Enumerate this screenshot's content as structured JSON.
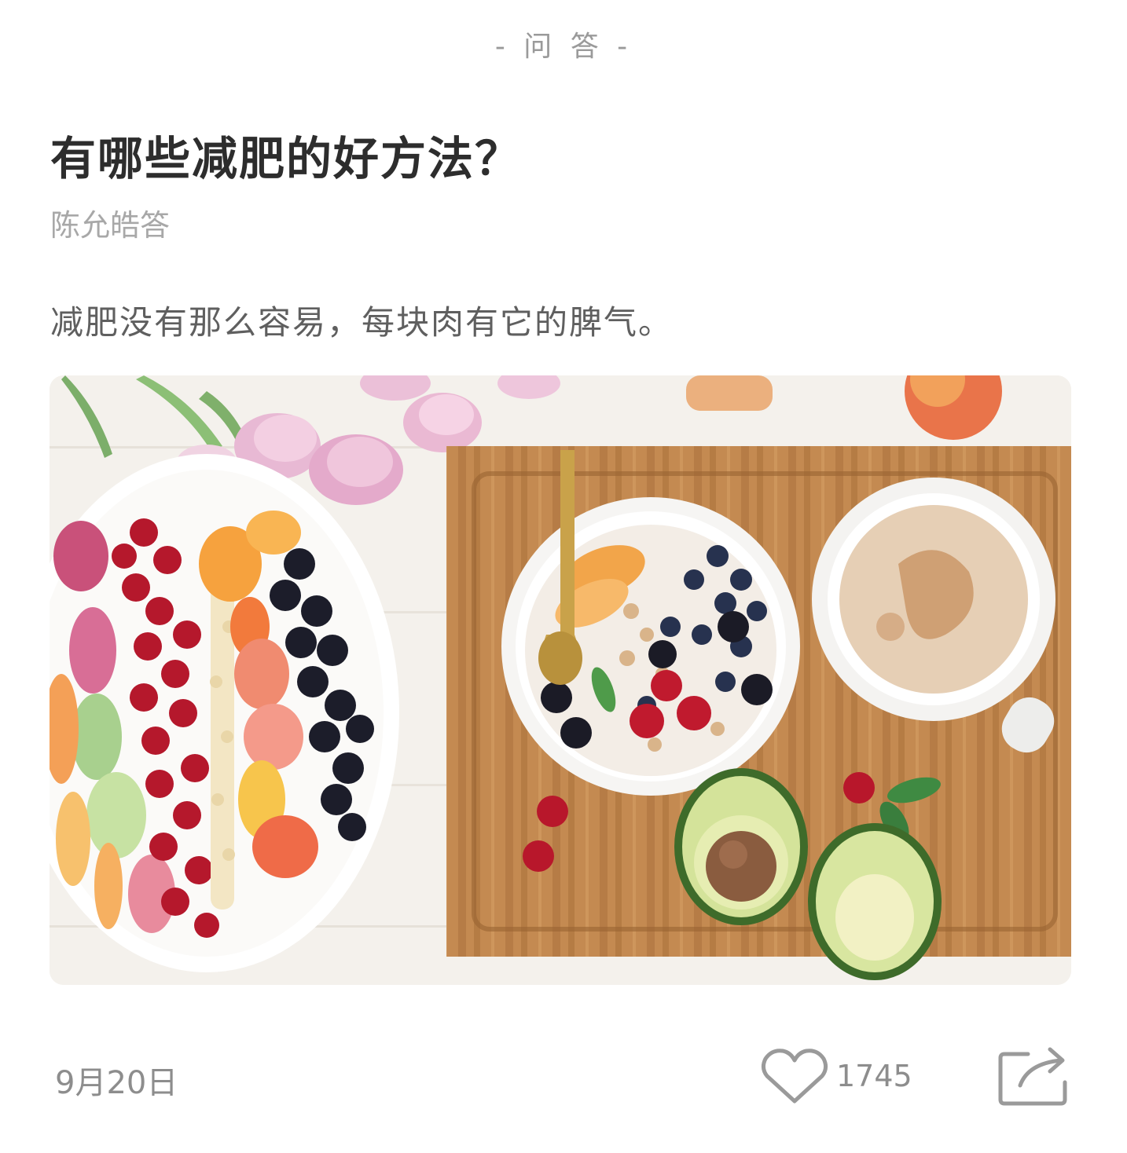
{
  "header": {
    "section_label": "- 问 答 -"
  },
  "question": {
    "title": "有哪些减肥的好方法？",
    "author": "陈允皓答",
    "excerpt": "减肥没有那么容易，每块肉有它的脾气。"
  },
  "image": {
    "description_icon": "photo-healthy-breakfast"
  },
  "footer": {
    "date": "9月20日",
    "like_count": "1745",
    "like_icon": "heart-outline-icon",
    "share_icon": "share-icon"
  },
  "colors": {
    "text_primary": "#2d2d2d",
    "text_secondary": "#9a9a9a",
    "icon_gray": "#9a9a9a"
  }
}
